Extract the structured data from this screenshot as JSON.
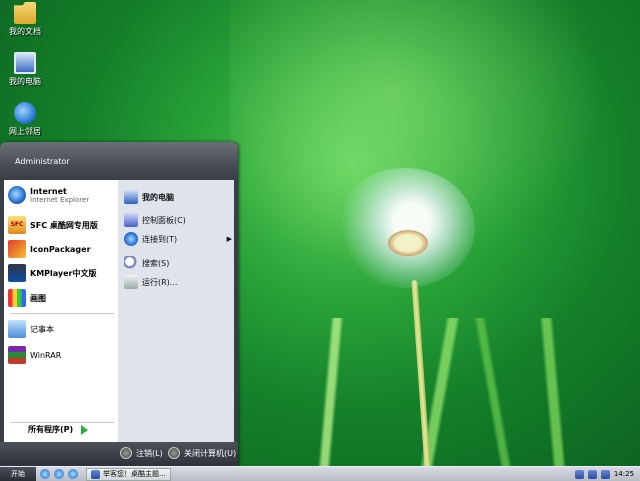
{
  "desktop": {
    "icons": [
      {
        "label": "我的文档",
        "icon": "folder-docs-icon"
      },
      {
        "label": "我的电脑",
        "icon": "computer-icon"
      },
      {
        "label": "网上邻居",
        "icon": "network-icon"
      }
    ]
  },
  "start_menu": {
    "user": "Administrator",
    "left_items": [
      {
        "label": "Internet",
        "sub": "Internet Explorer",
        "icon": "internet-explorer-icon"
      },
      {
        "label": "SFC 桌酷网专用版",
        "icon": "sfc-icon"
      },
      {
        "label": "IconPackager",
        "icon": "iconpackager-icon"
      },
      {
        "label": "KMPlayer中文版",
        "icon": "kmplayer-icon"
      },
      {
        "label": "画图",
        "icon": "paint-icon"
      },
      {
        "label": "记事本",
        "icon": "notepad-icon"
      },
      {
        "label": "WinRAR",
        "icon": "winrar-icon"
      }
    ],
    "all_programs": "所有程序(P)",
    "right_items": [
      {
        "label": "我的电脑",
        "icon": "my-computer-icon"
      },
      {
        "label": "控制面板(C)",
        "icon": "control-panel-icon"
      },
      {
        "label": "连接到(T)",
        "icon": "connect-to-icon",
        "has_submenu": true
      },
      {
        "label": "搜索(S)",
        "icon": "search-icon"
      },
      {
        "label": "运行(R)...",
        "icon": "run-icon"
      }
    ],
    "logoff": "注销(L)",
    "shutdown": "关闭计算机(U)"
  },
  "taskbar": {
    "start": "开始",
    "task": "举客您！桌酷主题...",
    "clock": "14:25"
  }
}
